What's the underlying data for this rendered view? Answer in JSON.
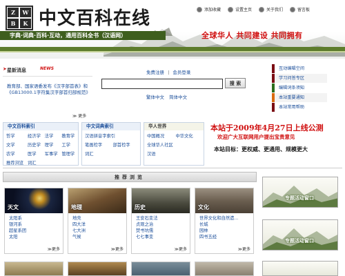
{
  "header": {
    "logo_letters": [
      "Z",
      "W",
      "B",
      "K"
    ],
    "site_title": "中文百科在线",
    "tagline": "字典·词典·百科·互动，通用百科全书（汉语网）",
    "slogan": "全球华人  共同建设  共同拥有",
    "top_links": [
      {
        "label": "添加收藏",
        "icon": "star-icon"
      },
      {
        "label": "设置主页",
        "icon": "home-icon"
      },
      {
        "label": "关于我们",
        "icon": "info-icon"
      },
      {
        "label": "留言板",
        "icon": "message-icon"
      }
    ]
  },
  "news": {
    "title": "星新消息",
    "badge": "NEWS",
    "items": [
      "教育部、国家语委发布《汉字部首表》和《GB13000.1字符集汉字部首归部规范》"
    ],
    "more": "更多"
  },
  "auth": {
    "register": "免费注册",
    "separator": "|",
    "login": "会员登录"
  },
  "search": {
    "placeholder": "",
    "button": "搜 索"
  },
  "lang": {
    "traditional": "繁体中文",
    "simplified": "简体中文"
  },
  "side_menu": [
    "互动编辑空间",
    "学习问答专区",
    "编辑词条须知",
    "本站重要通知",
    "本站常用帮助"
  ],
  "categories": [
    {
      "title": "中文百科索引",
      "items": [
        "哲学",
        "经济学",
        "法学",
        "教育学",
        "文学",
        "历史学",
        "理学",
        "工学",
        "农学",
        "医学",
        "军事学",
        "管理学",
        "推荐浏览",
        "词汇"
      ]
    },
    {
      "title": "中文词典索引",
      "items": [
        "汉语拼音字索引",
        "笔画检字",
        "部首检字",
        "词汇"
      ]
    },
    {
      "title": "华人世界",
      "items": [
        "中国概况",
        "中华文化",
        "全球华人社区",
        "汉语"
      ]
    }
  ],
  "announcement": {
    "headline": "本站于2009年4月27日上线公测",
    "sub": "欢迎广大互联网用户提出宝贵意见",
    "goal": "本站目标：更权威、更通用、规模更大"
  },
  "recommend": {
    "title": "推荐浏览",
    "cards": [
      {
        "label": "天文",
        "links": [
          "太阳系",
          "银河系",
          "超星系团",
          "太阳"
        ],
        "more": "更多"
      },
      {
        "label": "地理",
        "links": [
          "地壳",
          "四大洋",
          "七大洲",
          "气候"
        ],
        "more": "更多"
      },
      {
        "label": "历史",
        "links": [
          "王安石变法",
          "贞观之治",
          "焚书坑儒",
          "七七事变"
        ],
        "more": "更多"
      },
      {
        "label": "文化",
        "links": [
          "世界文化和自然遗...",
          "长城",
          "园林",
          "四书五经"
        ],
        "more": "更多"
      }
    ]
  },
  "events": [
    {
      "label": "专题活动窗口"
    },
    {
      "label": "专题活动窗口"
    }
  ]
}
